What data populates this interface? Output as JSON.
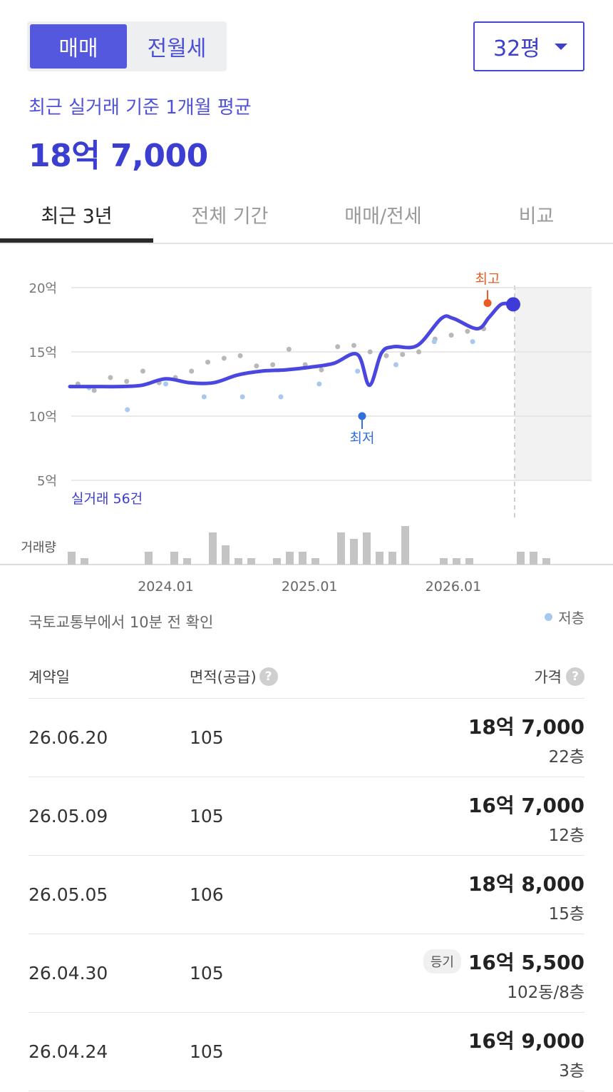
{
  "toggle": {
    "sale": "매매",
    "rent": "전월세"
  },
  "size_select": {
    "value": "32평"
  },
  "summary": {
    "label": "최근 실거래 기준 1개월 평균",
    "value": "18억 7,000"
  },
  "tabs": [
    {
      "label": "최근 3년"
    },
    {
      "label": "전체 기간"
    },
    {
      "label": "매매/전세"
    },
    {
      "label": "비교"
    }
  ],
  "chart_data": {
    "type": "line",
    "x_ticks": [
      "2024.01",
      "2025.01",
      "2026.01"
    ],
    "y_ticks": [
      "20억",
      "15억",
      "10억",
      "5억"
    ],
    "ylim": [
      5,
      20
    ],
    "y_unit": "억",
    "count_label": "실거래 56건",
    "high_label": "최고",
    "low_label": "최저",
    "volume_label": "거래량",
    "grid": true,
    "series": [
      {
        "x": [
          "2023.05",
          "2023.07",
          "2023.09",
          "2023.11",
          "2024.01",
          "2024.03",
          "2024.05",
          "2024.07",
          "2024.09",
          "2024.11",
          "2025.01",
          "2025.03",
          "2025.05",
          "2025.06",
          "2025.07",
          "2025.08",
          "2025.10",
          "2025.12",
          "2026.01",
          "2026.03",
          "2026.04",
          "2026.05",
          "2026.06"
        ],
        "values": [
          12.3,
          12.3,
          12.3,
          12.4,
          12.9,
          12.6,
          12.6,
          13.2,
          13.5,
          13.6,
          13.8,
          14.1,
          14.8,
          12.4,
          14.9,
          15.4,
          15.5,
          17.6,
          17.6,
          16.8,
          17.7,
          18.7,
          18.7
        ]
      }
    ],
    "volume": [
      2,
      1,
      0,
      0,
      0,
      0,
      2,
      0,
      2,
      1,
      0,
      5,
      3,
      1,
      1,
      0,
      1,
      2,
      2,
      1,
      0,
      5,
      4,
      5,
      2,
      2,
      6,
      0,
      0,
      1,
      1,
      1,
      0,
      0,
      0,
      2,
      2,
      1
    ],
    "scatter_gray": [
      12.5,
      12.0,
      13.0,
      12.7,
      13.5,
      12.6,
      13.0,
      13.5,
      14.2,
      14.5,
      14.7,
      13.9,
      14.0,
      15.2,
      14.0,
      13.6,
      15.4,
      15.5,
      15.0,
      14.7,
      14.8,
      15.0,
      16.0,
      16.3,
      16.6,
      16.8
    ],
    "scatter_blue": [
      12.2,
      10.5,
      12.5,
      11.5,
      11.5,
      11.5,
      12.5,
      13.5,
      14.0,
      15.8,
      15.8
    ]
  },
  "table": {
    "source": "국토교통부에서 10분 전 확인",
    "legend_low": "저층",
    "headers": {
      "date": "계약일",
      "area": "면적(공급)",
      "price": "가격"
    },
    "help_glyph": "?",
    "rows": [
      {
        "date": "26.06.20",
        "area": "105",
        "price": "18억 7,000",
        "floor": "22층",
        "badge": ""
      },
      {
        "date": "26.05.09",
        "area": "105",
        "price": "16억 7,000",
        "floor": "12층",
        "badge": ""
      },
      {
        "date": "26.05.05",
        "area": "106",
        "price": "18억 8,000",
        "floor": "15층",
        "badge": ""
      },
      {
        "date": "26.04.30",
        "area": "105",
        "price": "16억 5,500",
        "floor": "102동/8층",
        "badge": "등기"
      },
      {
        "date": "26.04.24",
        "area": "105",
        "price": "16억 9,000",
        "floor": "3층",
        "badge": ""
      }
    ]
  },
  "colors": {
    "accent": "#3b3ed0",
    "high": "#ea5a24",
    "low": "#2f6fe0",
    "blue_dot": "#a8c8f0",
    "gray_dot": "#b8b8b8",
    "bar": "#c4c4c4"
  }
}
